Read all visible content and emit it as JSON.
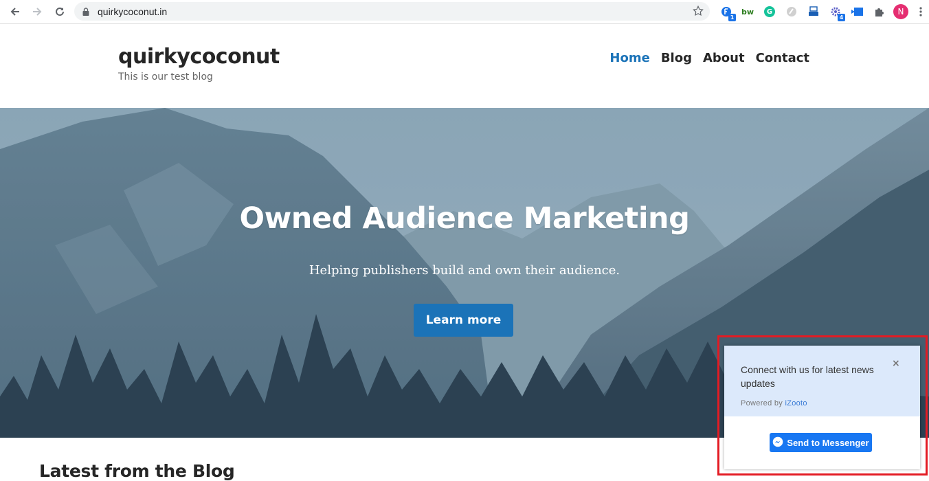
{
  "browser": {
    "url": "quirkycoconut.in",
    "profile_initial": "N",
    "extensions": [
      {
        "icon": "feedly-icon",
        "badge": "1"
      },
      {
        "icon": "bw-icon",
        "text": "bw"
      },
      {
        "icon": "grammarly-icon",
        "text": "G"
      },
      {
        "icon": "gray-circle-icon"
      },
      {
        "icon": "printer-ext-icon"
      },
      {
        "icon": "gear-ext-icon",
        "badge": "4"
      },
      {
        "icon": "cast-ext-icon"
      },
      {
        "icon": "puzzle-icon"
      }
    ]
  },
  "site": {
    "title": "quirkycoconut",
    "tagline": "This is our test blog",
    "nav": [
      "Home",
      "Blog",
      "About",
      "Contact"
    ],
    "active_nav": "Home"
  },
  "hero": {
    "title": "Owned Audience Marketing",
    "subtitle": "Helping publishers build and own their audience.",
    "button": "Learn more"
  },
  "blog": {
    "heading": "Latest from the Blog"
  },
  "widget": {
    "message": "Connect with us for latest news updates",
    "close": "×",
    "powered_prefix": "Powered by ",
    "powered_brand": "iZooto",
    "button": "Send to Messenger"
  },
  "colors": {
    "accent": "#1b73b8",
    "highlight": "#e31b23",
    "messenger": "#1877f2",
    "widget_bg": "#dce9fb"
  }
}
